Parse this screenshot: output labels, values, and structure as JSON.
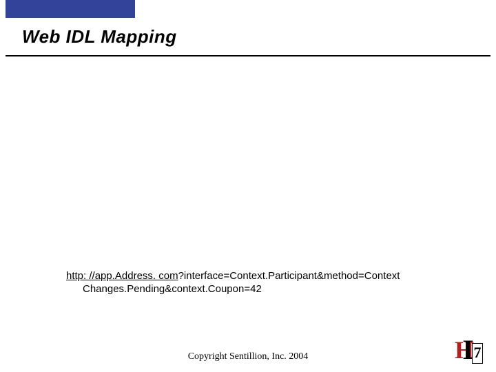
{
  "title": "Web IDL Mapping",
  "url": {
    "linkPart": "http: //app.Address. com",
    "queryPart1": "?interface=Context.Participant&method=Context",
    "line2": "Changes.Pending&context.Coupon=42"
  },
  "copyright": "Copyright Sentillion, Inc. 2004",
  "logo": {
    "h": "H",
    "l": "L",
    "seven": "7"
  }
}
